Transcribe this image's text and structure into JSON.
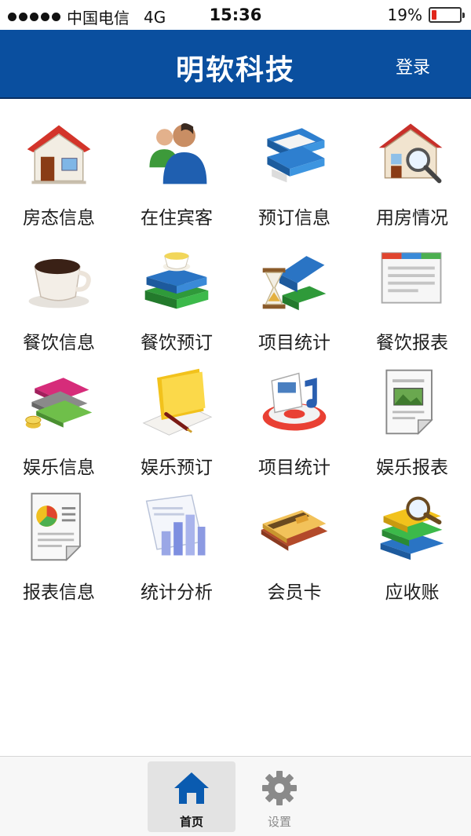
{
  "status_bar": {
    "carrier": "中国电信",
    "network": "4G",
    "time": "15:36",
    "battery_text": "19%",
    "battery_level": 0.19,
    "battery_color": "#e0261b"
  },
  "header": {
    "title": "明软科技",
    "login_label": "登录",
    "background": "#0a4f9f"
  },
  "menu": [
    {
      "label": "房态信息",
      "icon": "house-icon"
    },
    {
      "label": "在住宾客",
      "icon": "guests-icon"
    },
    {
      "label": "预订信息",
      "icon": "reservation-stack-icon"
    },
    {
      "label": "用房情况",
      "icon": "house-search-icon"
    },
    {
      "label": "餐饮信息",
      "icon": "coffee-cup-icon"
    },
    {
      "label": "餐饮预订",
      "icon": "tea-books-icon"
    },
    {
      "label": "项目统计",
      "icon": "hourglass-books-icon"
    },
    {
      "label": "餐饮报表",
      "icon": "report-window-icon"
    },
    {
      "label": "娱乐信息",
      "icon": "money-coins-icon"
    },
    {
      "label": "娱乐预订",
      "icon": "folder-pen-icon"
    },
    {
      "label": "项目统计",
      "icon": "media-disc-icon"
    },
    {
      "label": "娱乐报表",
      "icon": "image-document-icon"
    },
    {
      "label": "报表信息",
      "icon": "pie-document-icon"
    },
    {
      "label": "统计分析",
      "icon": "bar-chart-icon"
    },
    {
      "label": "会员卡",
      "icon": "member-cards-icon"
    },
    {
      "label": "应收账",
      "icon": "books-magnifier-icon"
    }
  ],
  "tab_bar": {
    "home_label": "首页",
    "settings_label": "设置",
    "active_tab": "首页",
    "active_color": "#0a5bb0",
    "inactive_color": "#8a8a8a"
  }
}
